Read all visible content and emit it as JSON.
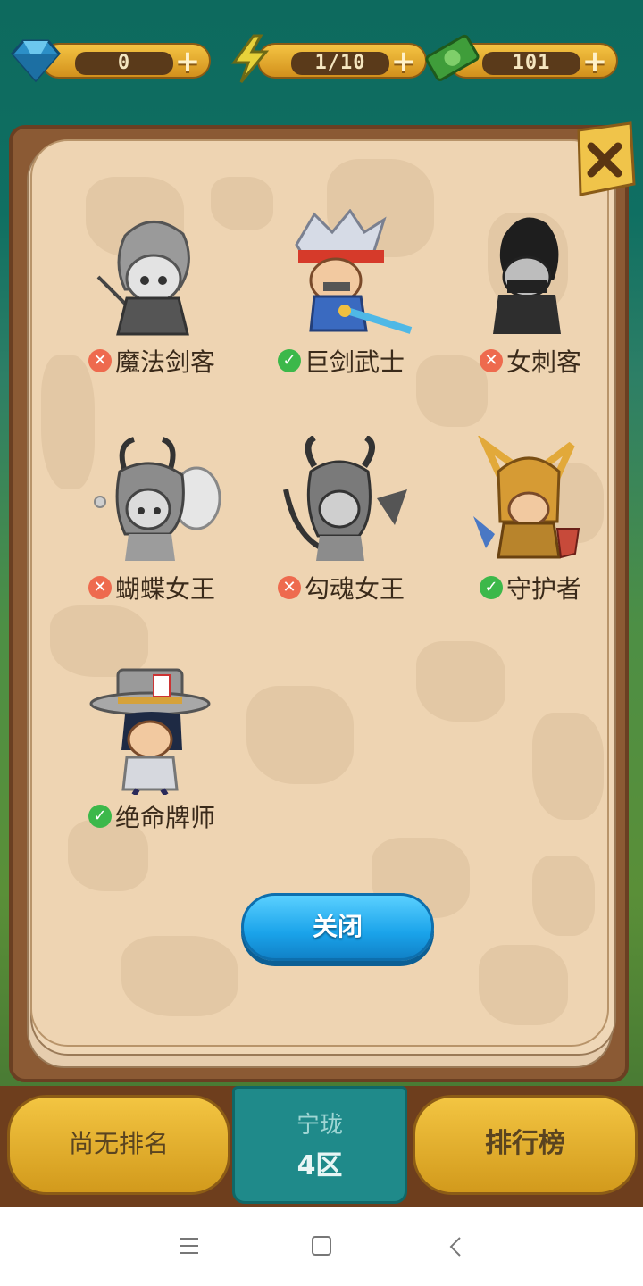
{
  "resources": [
    {
      "icon": "diamond-icon",
      "value": "0"
    },
    {
      "icon": "lightning-icon",
      "value": "1/10"
    },
    {
      "icon": "cash-icon",
      "value": "101"
    }
  ],
  "heroes": [
    {
      "name": "魔法剑客",
      "owned": false,
      "badge": "✕",
      "portrait": "hero-portrait-swordmage"
    },
    {
      "name": "巨剑武士",
      "owned": true,
      "badge": "✓",
      "portrait": "hero-portrait-greatsword"
    },
    {
      "name": "女刺客",
      "owned": false,
      "badge": "✕",
      "portrait": "hero-portrait-assassin"
    },
    {
      "name": "蝴蝶女王",
      "owned": false,
      "badge": "✕",
      "portrait": "hero-portrait-butterfly-queen"
    },
    {
      "name": "勾魂女王",
      "owned": false,
      "badge": "✕",
      "portrait": "hero-portrait-soul-queen"
    },
    {
      "name": "守护者",
      "owned": true,
      "badge": "✓",
      "portrait": "hero-portrait-guardian"
    },
    {
      "name": "绝命牌师",
      "owned": true,
      "badge": "✓",
      "portrait": "hero-portrait-card-master"
    }
  ],
  "dialog": {
    "close_label": "关闭"
  },
  "bottom": {
    "rank_label": "尚无排名",
    "zone_region": "宁珑",
    "zone_number": "4区",
    "leaderboard_label": "排行榜"
  },
  "colors": {
    "owned_badge": "#3cb84a",
    "locked_badge": "#ee6a4e",
    "button_blue": "#1aa3ea",
    "gold": "#f3c542",
    "page": "#eed4b2"
  }
}
